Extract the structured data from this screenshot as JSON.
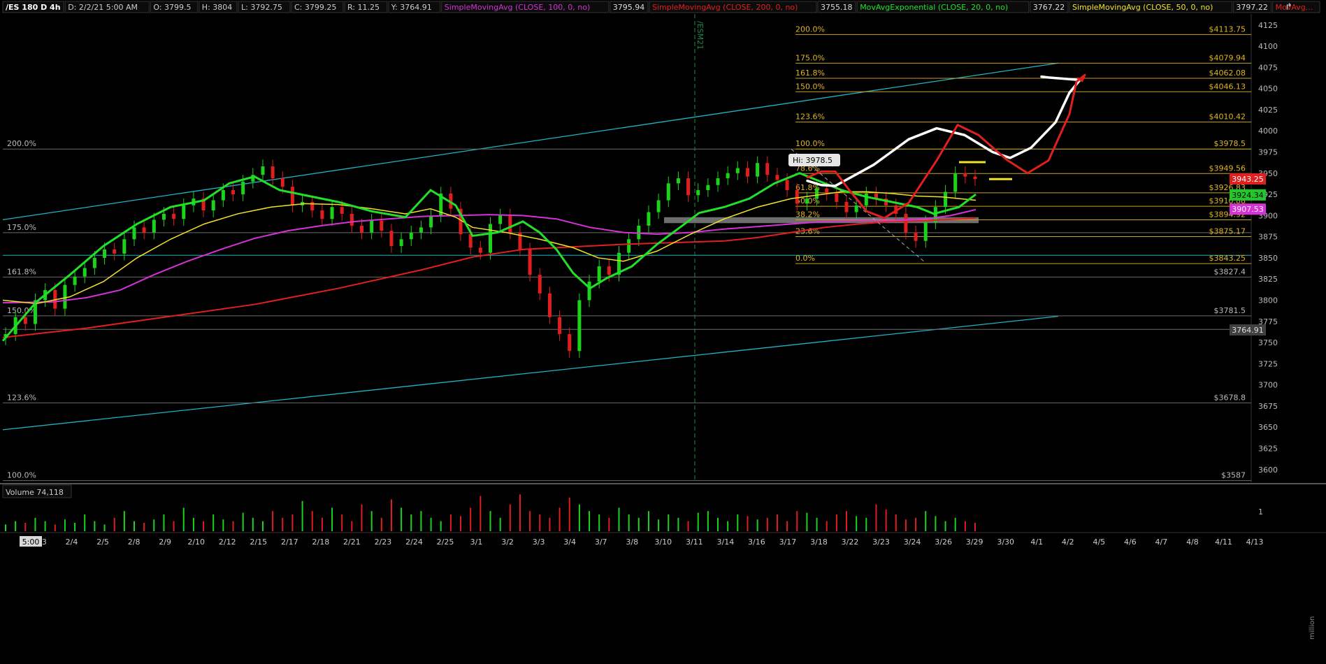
{
  "header": {
    "symbol": "/ES 180 D 4h",
    "date": "D: 2/2/21 5:00 AM",
    "open": "O: 3799.5",
    "high": "H: 3804",
    "low": "L: 3792.75",
    "close": "C: 3799.25",
    "range": "R: 11.25",
    "y": "Y: 3764.91",
    "studies": [
      {
        "label": "SimpleMovingAvg (CLOSE, 100, 0, no)",
        "value": "3795.94",
        "color": "#d632d6"
      },
      {
        "label": "SimpleMovingAvg (CLOSE, 200, 0, no)",
        "value": "3755.18",
        "color": "#e0201e"
      },
      {
        "label": "MovAvgExponential (CLOSE, 20, 0, no)",
        "value": "3767.22",
        "color": "#22e02a"
      },
      {
        "label": "SimpleMovingAvg (CLOSE, 50, 0, no)",
        "value": "3797.22",
        "color": "#f2e22a"
      },
      {
        "label": "MovAvg...",
        "value": "",
        "color": "#e0201e"
      }
    ]
  },
  "price_axis": {
    "ticks": [
      "4125",
      "4100",
      "4075",
      "4050",
      "4025",
      "4000",
      "3975",
      "3950",
      "3925",
      "3900",
      "3875",
      "3850",
      "3825",
      "3800",
      "3775",
      "3750",
      "3725",
      "3700",
      "3675",
      "3650",
      "3625",
      "3600"
    ],
    "price_tags": [
      {
        "text": "3943.25",
        "value": 3943.25,
        "bg": "#e0201e",
        "fg": "#ffffff"
      },
      {
        "text": "3924.34",
        "value": 3924.34,
        "bg": "#22c82a",
        "fg": "#000000"
      },
      {
        "text": "3907.53",
        "value": 3907.53,
        "bg": "#d632d6",
        "fg": "#ffffff"
      },
      {
        "text": "3764.91",
        "value": 3764.91,
        "bg": "#404040",
        "fg": "#dddddd"
      }
    ]
  },
  "date_axis": {
    "cursor_label": "5:00",
    "labels": [
      "2/3",
      "2/4",
      "2/5",
      "2/8",
      "2/9",
      "2/10",
      "2/12",
      "2/15",
      "2/17",
      "2/18",
      "2/21",
      "2/23",
      "2/24",
      "2/25",
      "3/1",
      "3/2",
      "3/3",
      "3/4",
      "3/7",
      "3/8",
      "3/10",
      "3/11",
      "3/14",
      "3/16",
      "3/17",
      "3/18",
      "3/22",
      "3/23",
      "3/24",
      "3/26",
      "3/29",
      "3/30",
      "4/1",
      "4/2",
      "4/5",
      "4/6",
      "4/7",
      "4/8",
      "4/11",
      "4/13"
    ]
  },
  "contract_marker": "/ESM21",
  "hi_label": "Hi: 3978.5",
  "volume_panel": {
    "label": "Volume",
    "value": "74,118",
    "ticks": [
      "1"
    ],
    "unit": "million"
  },
  "chart_data": {
    "type": "candlestick",
    "y_range": [
      3585,
      4138
    ],
    "left_fib": [
      {
        "pct": "200.0%",
        "price": 3978.5
      },
      {
        "pct": "175.0%",
        "price": 3879.75
      },
      {
        "pct": "161.8%",
        "price": 3827.4
      },
      {
        "pct": "150.0%",
        "price": 3781.5
      },
      {
        "pct": "123.6%",
        "price": 3678.8
      },
      {
        "pct": "100.0%",
        "price": 3587
      }
    ],
    "right_fib": [
      {
        "pct": "200.0%",
        "price": 4113.75,
        "label": "$4113.75"
      },
      {
        "pct": "175.0%",
        "price": 4079.94,
        "label": "$4079.94"
      },
      {
        "pct": "161.8%",
        "price": 4062.08,
        "label": "$4062.08"
      },
      {
        "pct": "150.0%",
        "price": 4046.13,
        "label": "$4046.13"
      },
      {
        "pct": "123.6%",
        "price": 4010.42,
        "label": "$4010.42"
      },
      {
        "pct": "100.0%",
        "price": 3978.5,
        "label": "$3978.5"
      },
      {
        "pct": "78.6%",
        "price": 3949.56,
        "label": "$3949.56"
      },
      {
        "pct": "61.8%",
        "price": 3926.83,
        "label": "$3926.83"
      },
      {
        "pct": "50.0%",
        "price": 3910.88,
        "label": "$3910.88"
      },
      {
        "pct": "38.2%",
        "price": 3894.92,
        "label": "$3894.92"
      },
      {
        "pct": "23.6%",
        "price": 3875.17,
        "label": "$3875.17"
      },
      {
        "pct": "0.0%",
        "price": 3843.25,
        "label": "$3843.25"
      }
    ],
    "price_labels": [
      {
        "text": "$3827.4",
        "price": 3827.4
      },
      {
        "text": "$3781.5",
        "price": 3781.5
      },
      {
        "text": "$3678.8",
        "price": 3678.8
      },
      {
        "text": "$3587",
        "price": 3587
      }
    ],
    "horizontal_lines": [
      3853,
      3765.5
    ],
    "support_zone": [
      3891,
      3898
    ],
    "ema20": [
      [
        0,
        3752
      ],
      [
        40,
        3798
      ],
      [
        80,
        3830
      ],
      [
        120,
        3864
      ],
      [
        160,
        3890
      ],
      [
        200,
        3910
      ],
      [
        240,
        3918
      ],
      [
        270,
        3938
      ],
      [
        300,
        3946
      ],
      [
        330,
        3930
      ],
      [
        360,
        3924
      ],
      [
        400,
        3916
      ],
      [
        440,
        3905
      ],
      [
        480,
        3898
      ],
      [
        510,
        3930
      ],
      [
        540,
        3912
      ],
      [
        560,
        3876
      ],
      [
        590,
        3880
      ],
      [
        620,
        3893
      ],
      [
        640,
        3880
      ],
      [
        660,
        3860
      ],
      [
        680,
        3832
      ],
      [
        700,
        3814
      ],
      [
        720,
        3826
      ],
      [
        750,
        3840
      ],
      [
        780,
        3866
      ],
      [
        810,
        3888
      ],
      [
        830,
        3903
      ],
      [
        860,
        3910
      ],
      [
        890,
        3920
      ],
      [
        920,
        3938
      ],
      [
        950,
        3950
      ],
      [
        970,
        3942
      ],
      [
        1000,
        3930
      ],
      [
        1030,
        3922
      ],
      [
        1060,
        3916
      ],
      [
        1090,
        3910
      ],
      [
        1110,
        3902
      ],
      [
        1140,
        3910
      ],
      [
        1160,
        3925
      ]
    ],
    "sma50": [
      [
        0,
        3800
      ],
      [
        40,
        3796
      ],
      [
        80,
        3804
      ],
      [
        120,
        3822
      ],
      [
        160,
        3850
      ],
      [
        200,
        3872
      ],
      [
        240,
        3890
      ],
      [
        280,
        3902
      ],
      [
        320,
        3910
      ],
      [
        360,
        3914
      ],
      [
        400,
        3913
      ],
      [
        440,
        3908
      ],
      [
        480,
        3902
      ],
      [
        510,
        3908
      ],
      [
        540,
        3898
      ],
      [
        560,
        3886
      ],
      [
        600,
        3880
      ],
      [
        640,
        3872
      ],
      [
        680,
        3862
      ],
      [
        710,
        3850
      ],
      [
        740,
        3846
      ],
      [
        780,
        3858
      ],
      [
        820,
        3878
      ],
      [
        860,
        3896
      ],
      [
        900,
        3910
      ],
      [
        940,
        3920
      ],
      [
        970,
        3924
      ],
      [
        1000,
        3928
      ],
      [
        1030,
        3928
      ],
      [
        1060,
        3926
      ],
      [
        1090,
        3923
      ],
      [
        1120,
        3922
      ],
      [
        1160,
        3918
      ]
    ],
    "sma100": [
      [
        0,
        3797
      ],
      [
        60,
        3798
      ],
      [
        100,
        3803
      ],
      [
        140,
        3812
      ],
      [
        180,
        3830
      ],
      [
        220,
        3846
      ],
      [
        260,
        3860
      ],
      [
        300,
        3873
      ],
      [
        340,
        3882
      ],
      [
        380,
        3888
      ],
      [
        420,
        3893
      ],
      [
        460,
        3896
      ],
      [
        500,
        3899
      ],
      [
        540,
        3900
      ],
      [
        580,
        3901
      ],
      [
        620,
        3900
      ],
      [
        660,
        3896
      ],
      [
        700,
        3886
      ],
      [
        740,
        3880
      ],
      [
        780,
        3878
      ],
      [
        820,
        3880
      ],
      [
        860,
        3884
      ],
      [
        900,
        3887
      ],
      [
        940,
        3890
      ],
      [
        980,
        3893
      ],
      [
        1020,
        3894
      ],
      [
        1060,
        3894
      ],
      [
        1100,
        3896
      ],
      [
        1130,
        3900
      ],
      [
        1160,
        3907
      ]
    ],
    "sma200": [
      [
        0,
        3756
      ],
      [
        100,
        3767
      ],
      [
        200,
        3781
      ],
      [
        300,
        3795
      ],
      [
        400,
        3814
      ],
      [
        500,
        3836
      ],
      [
        560,
        3851
      ],
      [
        620,
        3860
      ],
      [
        680,
        3863
      ],
      [
        740,
        3866
      ],
      [
        800,
        3868
      ],
      [
        860,
        3870
      ],
      [
        900,
        3874
      ],
      [
        940,
        3880
      ],
      [
        980,
        3886
      ],
      [
        1020,
        3890
      ],
      [
        1060,
        3893
      ],
      [
        1100,
        3894
      ],
      [
        1140,
        3896
      ],
      [
        1160,
        3897
      ]
    ],
    "channel_lines": [
      {
        "from": [
          0,
          3895
        ],
        "to": [
          1510,
          4080
        ]
      },
      {
        "from": [
          0,
          3647
        ],
        "to": [
          1510,
          3781
        ]
      }
    ],
    "projection_white": [
      [
        1155,
        3941
      ],
      [
        1175,
        3936
      ],
      [
        1195,
        3935
      ],
      [
        1250,
        3960
      ],
      [
        1300,
        3990
      ],
      [
        1340,
        4003
      ],
      [
        1380,
        3995
      ],
      [
        1420,
        3975
      ],
      [
        1445,
        3968
      ],
      [
        1475,
        3980
      ],
      [
        1510,
        4010
      ],
      [
        1530,
        4045
      ],
      [
        1545,
        4060
      ],
      [
        1500,
        4063
      ],
      [
        1490,
        4064
      ]
    ],
    "projection_red": [
      [
        1155,
        3945
      ],
      [
        1175,
        3952
      ],
      [
        1195,
        3952
      ],
      [
        1215,
        3930
      ],
      [
        1240,
        3905
      ],
      [
        1265,
        3897
      ],
      [
        1300,
        3915
      ],
      [
        1340,
        3965
      ],
      [
        1370,
        4007
      ],
      [
        1400,
        3995
      ],
      [
        1440,
        3966
      ],
      [
        1470,
        3950
      ],
      [
        1500,
        3965
      ],
      [
        1530,
        4020
      ],
      [
        1540,
        4058
      ],
      [
        1552,
        4066
      ],
      [
        1548,
        4059
      ],
      [
        1542,
        4062
      ]
    ],
    "fib_dashed": {
      "from": [
        940,
        3978.5
      ],
      "to": [
        1098,
        3846
      ]
    },
    "series_close": [
      3760,
      3780,
      3772,
      3800,
      3812,
      3790,
      3818,
      3828,
      3838,
      3850,
      3860,
      3855,
      3872,
      3886,
      3880,
      3895,
      3902,
      3896,
      3912,
      3920,
      3906,
      3918,
      3930,
      3925,
      3940,
      3948,
      3958,
      3944,
      3934,
      3912,
      3916,
      3906,
      3896,
      3910,
      3902,
      3888,
      3880,
      3894,
      3882,
      3864,
      3872,
      3880,
      3886,
      3900,
      3926,
      3908,
      3878,
      3862,
      3856,
      3890,
      3900,
      3880,
      3860,
      3830,
      3808,
      3780,
      3760,
      3740,
      3800,
      3822,
      3840,
      3830,
      3856,
      3872,
      3888,
      3904,
      3918,
      3938,
      3944,
      3924,
      3930,
      3936,
      3944,
      3950,
      3956,
      3946,
      3962,
      3948,
      3942,
      3930,
      3914,
      3920,
      3932,
      3926,
      3916,
      3904,
      3912,
      3926,
      3920,
      3912,
      3902,
      3880,
      3870,
      3892,
      3910,
      3928,
      3950,
      3946,
      3943
    ],
    "volume": [
      0.2,
      0.3,
      0.25,
      0.4,
      0.3,
      0.2,
      0.35,
      0.25,
      0.5,
      0.3,
      0.2,
      0.4,
      0.6,
      0.3,
      0.25,
      0.35,
      0.5,
      0.3,
      0.7,
      0.4,
      0.3,
      0.5,
      0.35,
      0.3,
      0.55,
      0.4,
      0.3,
      0.6,
      0.4,
      0.5,
      0.9,
      0.6,
      0.4,
      0.7,
      0.5,
      0.3,
      0.8,
      0.6,
      0.4,
      0.95,
      0.7,
      0.5,
      0.6,
      0.4,
      0.3,
      0.5,
      0.45,
      0.7,
      1.05,
      0.6,
      0.4,
      0.8,
      1.1,
      0.6,
      0.5,
      0.4,
      0.7,
      1.0,
      0.8,
      0.6,
      0.5,
      0.4,
      0.7,
      0.5,
      0.4,
      0.6,
      0.35,
      0.5,
      0.4,
      0.3,
      0.55,
      0.6,
      0.4,
      0.3,
      0.5,
      0.45,
      0.35,
      0.4,
      0.5,
      0.3,
      0.6,
      0.55,
      0.4,
      0.3,
      0.5,
      0.6,
      0.45,
      0.4,
      0.8,
      0.65,
      0.5,
      0.35,
      0.4,
      0.6,
      0.45,
      0.3,
      0.4,
      0.3,
      0.25
    ]
  }
}
